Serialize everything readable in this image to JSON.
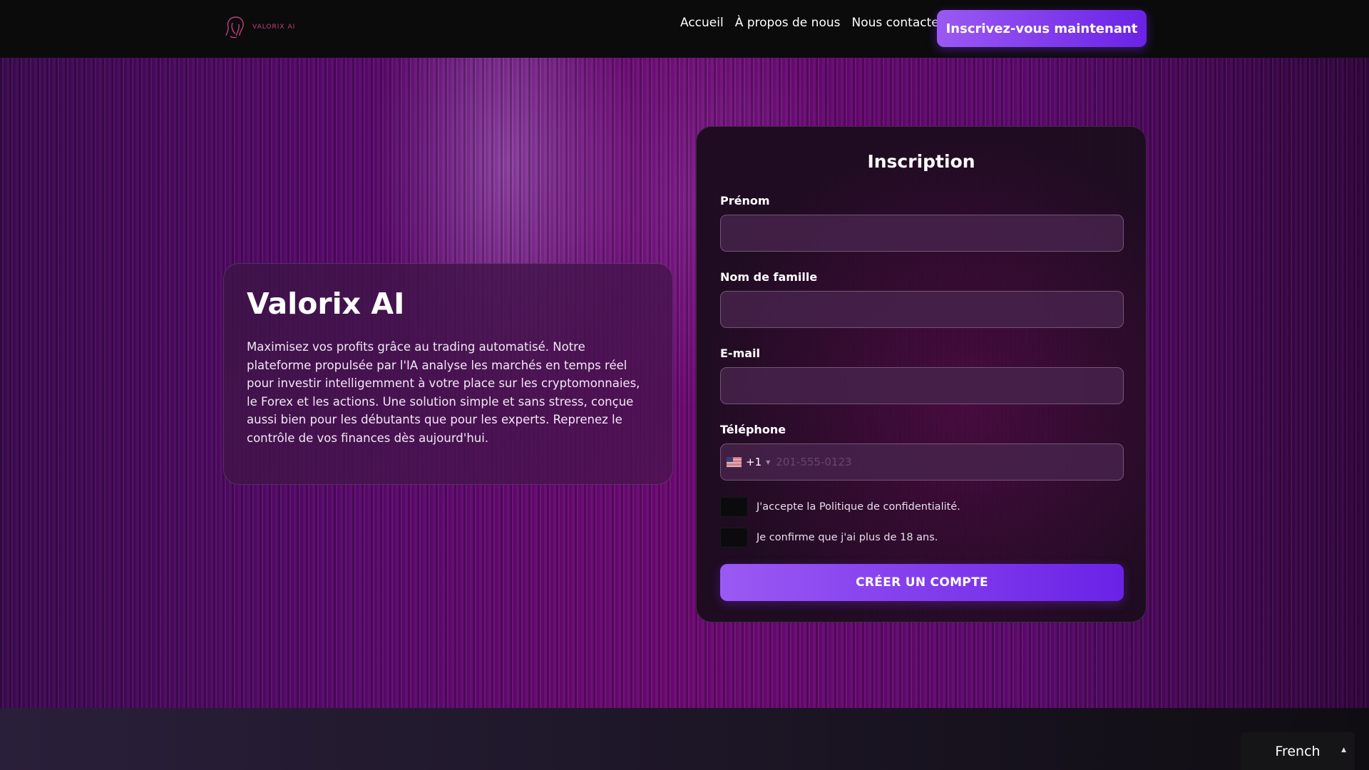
{
  "header": {
    "logo_text": "VALORIX AI",
    "nav": [
      {
        "label": "Accueil"
      },
      {
        "label": "À propos de nous"
      },
      {
        "label": "Nous contacter"
      }
    ],
    "cta_label": "Inscrivez-vous maintenant"
  },
  "hero": {
    "title": "Valorix AI",
    "description": "Maximisez vos profits grâce au trading automatisé. Notre plateforme propulsée par l'IA analyse les marchés en temps réel pour investir intelligemment à votre place sur les cryptomonnaies, le Forex et les actions. Une solution simple et sans stress, conçue aussi bien pour les débutants que pour les experts. Reprenez le contrôle de vos finances dès aujourd'hui."
  },
  "form": {
    "title": "Inscription",
    "first_name_label": "Prénom",
    "last_name_label": "Nom de famille",
    "email_label": "E-mail",
    "phone_label": "Téléphone",
    "phone_dial_code": "+1",
    "phone_placeholder": "201-555-0123",
    "privacy_label": "J'accepte la Politique de confidentialité.",
    "age_label": "Je confirme que j'ai plus de 18 ans.",
    "submit_label": "CRÉER UN COMPTE"
  },
  "language": {
    "selected": "French"
  },
  "colors": {
    "accent_start": "#9b59f3",
    "accent_end": "#6a22e6",
    "logo": "#c2407a"
  }
}
